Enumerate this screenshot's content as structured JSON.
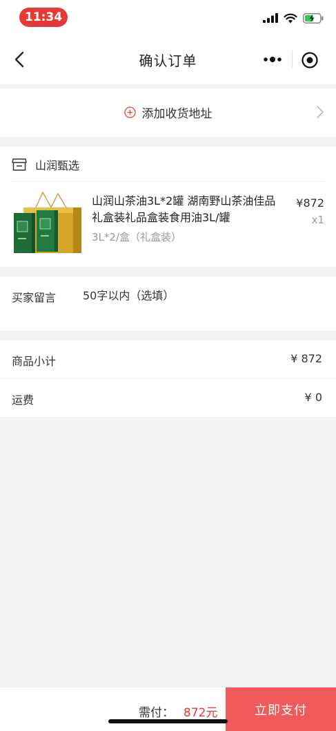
{
  "status_bar": {
    "time": "11:34"
  },
  "nav": {
    "title": "确认订单"
  },
  "address": {
    "add_label": "添加收货地址"
  },
  "shop": {
    "name": "山润甄选",
    "product": {
      "title": "山润山茶油3L*2罐 湖南野山茶油佳品礼盒装礼品盒装食用油3L/罐",
      "spec": "3L*2/盒（礼盒装）",
      "price": "¥872",
      "qty": "x1"
    }
  },
  "message": {
    "label": "买家留言",
    "placeholder": "50字以内（选填）"
  },
  "summary": {
    "subtotal_label": "商品小计",
    "subtotal_value": "¥ 872",
    "shipping_label": "运费",
    "shipping_value": "¥ 0"
  },
  "bottom": {
    "total_label": "需付：",
    "total_amount": "872元",
    "pay_label": "立即支付"
  },
  "colors": {
    "accent": "#e53935",
    "pay_button": "#ef5a5a",
    "background": "#f4f4f6"
  }
}
